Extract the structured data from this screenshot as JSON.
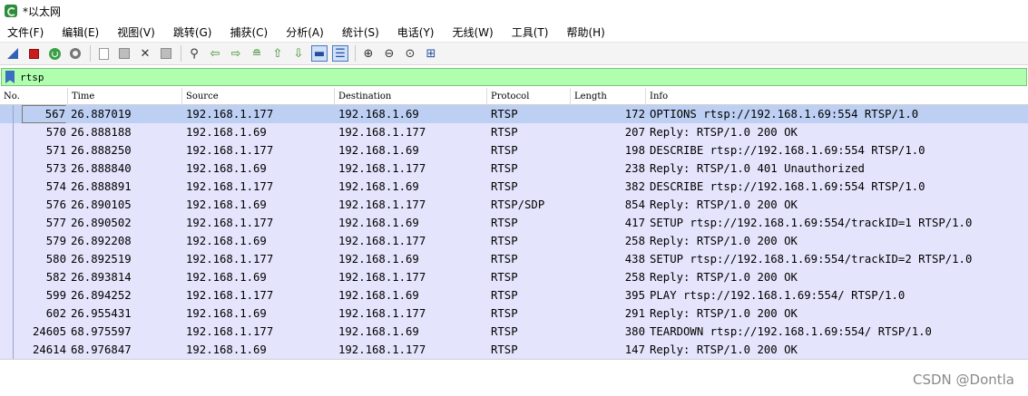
{
  "window": {
    "title": "*以太网"
  },
  "menu": [
    {
      "label": "文件(F)"
    },
    {
      "label": "编辑(E)"
    },
    {
      "label": "视图(V)"
    },
    {
      "label": "跳转(G)"
    },
    {
      "label": "捕获(C)"
    },
    {
      "label": "分析(A)"
    },
    {
      "label": "统计(S)"
    },
    {
      "label": "电话(Y)"
    },
    {
      "label": "无线(W)"
    },
    {
      "label": "工具(T)"
    },
    {
      "label": "帮助(H)"
    }
  ],
  "toolbar": {
    "icons": [
      "shark-fin-icon",
      "stop-icon",
      "restart-icon",
      "capture-options-icon",
      "open-file-icon",
      "save-file-icon",
      "close-file-icon",
      "reload-icon",
      "find-icon",
      "go-back-icon",
      "go-forward-icon",
      "go-to-packet-icon",
      "first-packet-icon",
      "last-packet-icon",
      "autoscroll-icon",
      "colorize-icon",
      "zoom-in-icon",
      "zoom-out-icon",
      "normal-size-icon",
      "resize-columns-icon"
    ]
  },
  "filter": {
    "value": "rtsp"
  },
  "columns": {
    "no": "No.",
    "time": "Time",
    "source": "Source",
    "destination": "Destination",
    "protocol": "Protocol",
    "length": "Length",
    "info": "Info"
  },
  "packets": [
    {
      "no": "567",
      "time": "26.887019",
      "source": "192.168.1.177",
      "destination": "192.168.1.69",
      "protocol": "RTSP",
      "length": "172",
      "info": "OPTIONS rtsp://192.168.1.69:554 RTSP/1.0"
    },
    {
      "no": "570",
      "time": "26.888188",
      "source": "192.168.1.69",
      "destination": "192.168.1.177",
      "protocol": "RTSP",
      "length": "207",
      "info": "Reply: RTSP/1.0 200 OK"
    },
    {
      "no": "571",
      "time": "26.888250",
      "source": "192.168.1.177",
      "destination": "192.168.1.69",
      "protocol": "RTSP",
      "length": "198",
      "info": "DESCRIBE rtsp://192.168.1.69:554 RTSP/1.0"
    },
    {
      "no": "573",
      "time": "26.888840",
      "source": "192.168.1.69",
      "destination": "192.168.1.177",
      "protocol": "RTSP",
      "length": "238",
      "info": "Reply: RTSP/1.0 401 Unauthorized"
    },
    {
      "no": "574",
      "time": "26.888891",
      "source": "192.168.1.177",
      "destination": "192.168.1.69",
      "protocol": "RTSP",
      "length": "382",
      "info": "DESCRIBE rtsp://192.168.1.69:554 RTSP/1.0"
    },
    {
      "no": "576",
      "time": "26.890105",
      "source": "192.168.1.69",
      "destination": "192.168.1.177",
      "protocol": "RTSP/SDP",
      "length": "854",
      "info": "Reply: RTSP/1.0 200 OK"
    },
    {
      "no": "577",
      "time": "26.890502",
      "source": "192.168.1.177",
      "destination": "192.168.1.69",
      "protocol": "RTSP",
      "length": "417",
      "info": "SETUP rtsp://192.168.1.69:554/trackID=1 RTSP/1.0"
    },
    {
      "no": "579",
      "time": "26.892208",
      "source": "192.168.1.69",
      "destination": "192.168.1.177",
      "protocol": "RTSP",
      "length": "258",
      "info": "Reply: RTSP/1.0 200 OK"
    },
    {
      "no": "580",
      "time": "26.892519",
      "source": "192.168.1.177",
      "destination": "192.168.1.69",
      "protocol": "RTSP",
      "length": "438",
      "info": "SETUP rtsp://192.168.1.69:554/trackID=2 RTSP/1.0"
    },
    {
      "no": "582",
      "time": "26.893814",
      "source": "192.168.1.69",
      "destination": "192.168.1.177",
      "protocol": "RTSP",
      "length": "258",
      "info": "Reply: RTSP/1.0 200 OK"
    },
    {
      "no": "599",
      "time": "26.894252",
      "source": "192.168.1.177",
      "destination": "192.168.1.69",
      "protocol": "RTSP",
      "length": "395",
      "info": "PLAY rtsp://192.168.1.69:554/ RTSP/1.0"
    },
    {
      "no": "602",
      "time": "26.955431",
      "source": "192.168.1.69",
      "destination": "192.168.1.177",
      "protocol": "RTSP",
      "length": "291",
      "info": "Reply: RTSP/1.0 200 OK"
    },
    {
      "no": "24605",
      "time": "68.975597",
      "source": "192.168.1.177",
      "destination": "192.168.1.69",
      "protocol": "RTSP",
      "length": "380",
      "info": "TEARDOWN rtsp://192.168.1.69:554/ RTSP/1.0"
    },
    {
      "no": "24614",
      "time": "68.976847",
      "source": "192.168.1.69",
      "destination": "192.168.1.177",
      "protocol": "RTSP",
      "length": "147",
      "info": "Reply: RTSP/1.0 200 OK"
    }
  ],
  "watermark": "CSDN @Dontla",
  "colors": {
    "row_background": "#e4e4fc",
    "selected_row": "#bdd0f3",
    "filter_valid": "#afffaf"
  }
}
